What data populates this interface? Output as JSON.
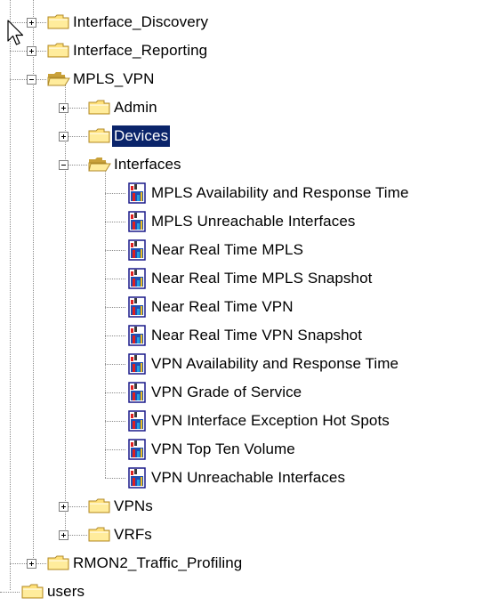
{
  "colors": {
    "selection_bg": "#0a246a",
    "selection_fg": "#ffffff",
    "folder": "#ffe17a",
    "report_blue": "#1f4fb4",
    "report_red": "#e02020"
  },
  "tree": {
    "nodes": [
      {
        "id": "interface-discovery",
        "label": "Interface_Discovery",
        "depth": 1,
        "type": "folder",
        "expander": "plus"
      },
      {
        "id": "interface-reporting",
        "label": "Interface_Reporting",
        "depth": 1,
        "type": "folder",
        "expander": "plus"
      },
      {
        "id": "mpls-vpn",
        "label": "MPLS_VPN",
        "depth": 1,
        "type": "folder-open",
        "expander": "minus"
      },
      {
        "id": "admin",
        "label": "Admin",
        "depth": 2,
        "type": "folder",
        "expander": "plus"
      },
      {
        "id": "devices",
        "label": "Devices",
        "depth": 2,
        "type": "folder",
        "expander": "plus",
        "selected": true
      },
      {
        "id": "interfaces",
        "label": "Interfaces",
        "depth": 2,
        "type": "folder-open",
        "expander": "minus"
      },
      {
        "id": "mpls-availability-and-response-time",
        "label": "MPLS Availability and Response Time",
        "depth": 3,
        "type": "report"
      },
      {
        "id": "mpls-unreachable-interfaces",
        "label": "MPLS Unreachable Interfaces",
        "depth": 3,
        "type": "report"
      },
      {
        "id": "near-real-time-mpls",
        "label": "Near Real Time MPLS",
        "depth": 3,
        "type": "report"
      },
      {
        "id": "near-real-time-mpls-snapshot",
        "label": "Near Real Time MPLS Snapshot",
        "depth": 3,
        "type": "report"
      },
      {
        "id": "near-real-time-vpn",
        "label": "Near Real Time VPN",
        "depth": 3,
        "type": "report"
      },
      {
        "id": "near-real-time-vpn-snapshot",
        "label": "Near Real Time VPN Snapshot",
        "depth": 3,
        "type": "report"
      },
      {
        "id": "vpn-availability-and-response-time",
        "label": "VPN Availability and Response Time",
        "depth": 3,
        "type": "report"
      },
      {
        "id": "vpn-grade-of-service",
        "label": "VPN Grade of Service",
        "depth": 3,
        "type": "report"
      },
      {
        "id": "vpn-interface-exception-hot-spots",
        "label": "VPN Interface Exception Hot Spots",
        "depth": 3,
        "type": "report"
      },
      {
        "id": "vpn-top-ten-volume",
        "label": "VPN Top Ten Volume",
        "depth": 3,
        "type": "report"
      },
      {
        "id": "vpn-unreachable-interfaces",
        "label": "VPN Unreachable Interfaces",
        "depth": 3,
        "type": "report"
      },
      {
        "id": "vpns",
        "label": "VPNs",
        "depth": 2,
        "type": "folder",
        "expander": "plus"
      },
      {
        "id": "vrfs",
        "label": "VRFs",
        "depth": 2,
        "type": "folder",
        "expander": "plus"
      },
      {
        "id": "rmon2-traffic-profiling",
        "label": "RMON2_Traffic_Profiling",
        "depth": 1,
        "type": "folder",
        "expander": "plus"
      },
      {
        "id": "users",
        "label": "users",
        "depth": 0,
        "type": "folder"
      }
    ]
  }
}
